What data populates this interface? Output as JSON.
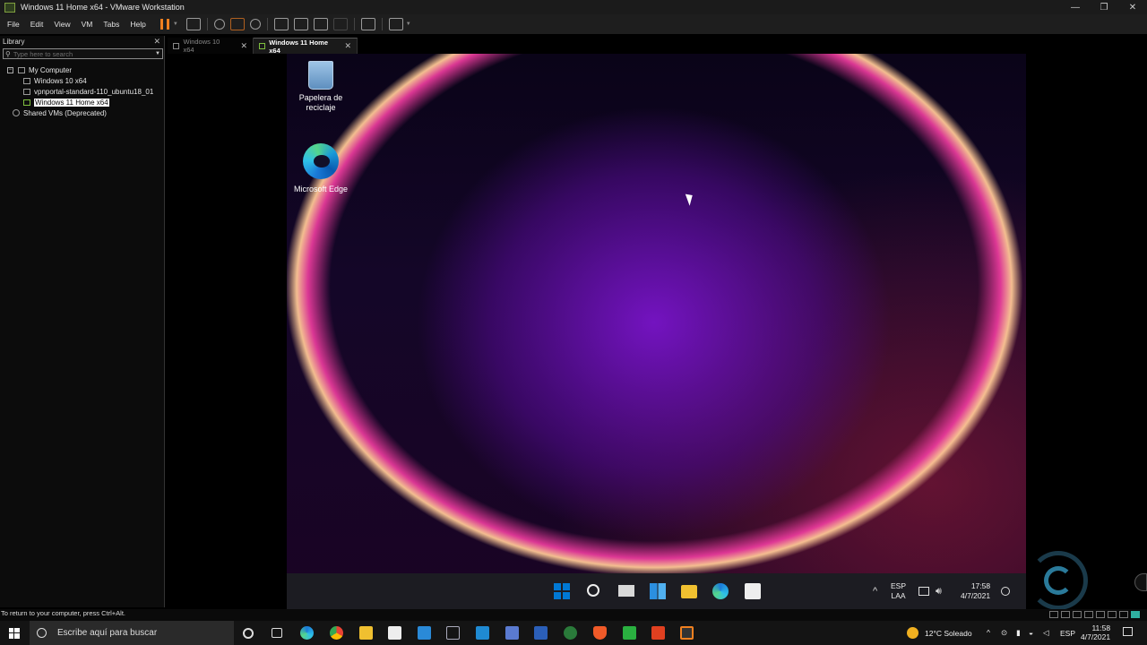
{
  "window": {
    "title": "Windows 11 Home x64 - VMware Workstation",
    "controls": {
      "minimize": "—",
      "restore": "❐",
      "close": "✕"
    }
  },
  "menubar": {
    "items": [
      "File",
      "Edit",
      "View",
      "VM",
      "Tabs",
      "Help"
    ]
  },
  "library": {
    "title": "Library",
    "close": "✕",
    "search_placeholder": "Type here to search",
    "tree": {
      "root": "My Computer",
      "vms": [
        "Windows 10 x64",
        "vpnportal-standard-110_ubuntu18_01",
        "Windows 11 Home x64"
      ],
      "shared": "Shared VMs (Deprecated)",
      "selected_index": 2
    }
  },
  "tabs": [
    {
      "label": "Windows 10 x64",
      "close": "✕",
      "active": false
    },
    {
      "label": "Windows 11 Home x64",
      "close": "✕",
      "active": true
    }
  ],
  "guest": {
    "desktop_icons": [
      {
        "label": "Papelera de reciclaje",
        "icon": "recycle-bin-icon"
      },
      {
        "label": "Microsoft Edge",
        "icon": "edge-icon"
      }
    ],
    "taskbar": {
      "lang": "ESP",
      "layout": "LAA",
      "time": "17:58",
      "date": "4/7/2021",
      "tray_chevron": "^"
    }
  },
  "status": {
    "message": "To return to your computer, press Ctrl+Alt."
  },
  "host_taskbar": {
    "search_placeholder": "Escribe aquí para buscar",
    "weather": "12°C  Soleado",
    "lang": "ESP",
    "time": "11:58",
    "date": "4/7/2021",
    "apps": [
      "cortana-icon",
      "task-view-icon",
      "edge-icon",
      "chrome-icon",
      "explorer-icon",
      "store-icon",
      "mail-icon",
      "network-tool-icon",
      "vscode-icon",
      "floppy-icon",
      "word-icon",
      "hs-icon",
      "brave-icon",
      "camtasia-icon",
      "recorder-icon",
      "vmware-icon"
    ]
  },
  "colors": {
    "accent": "#0078d4",
    "pause": "#f08020",
    "status_ok": "#2fb0a0"
  }
}
